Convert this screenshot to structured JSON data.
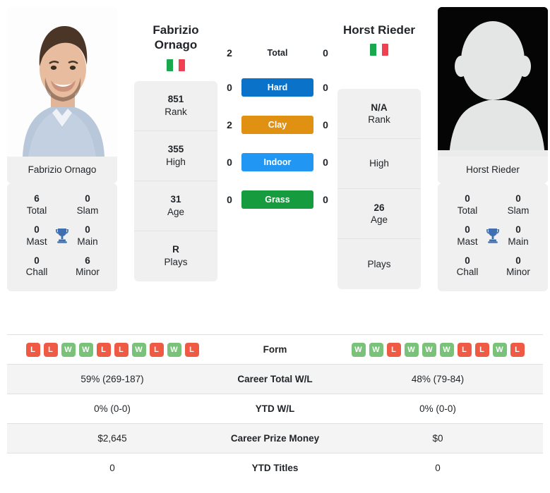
{
  "players": {
    "left": {
      "name": "Fabrizio Ornago",
      "name_line1": "Fabrizio",
      "name_line2": "Ornago",
      "caption": "Fabrizio Ornago",
      "flag": "italy",
      "info": [
        {
          "value": "851",
          "label": "Rank"
        },
        {
          "value": "355",
          "label": "High"
        },
        {
          "value": "31",
          "label": "Age"
        },
        {
          "value": "R",
          "label": "Plays"
        }
      ],
      "titles": [
        {
          "value": "6",
          "label": "Total"
        },
        {
          "value": "0",
          "label": "Slam"
        },
        {
          "value": "0",
          "label": "Mast"
        },
        {
          "value": "0",
          "label": "Main"
        },
        {
          "value": "0",
          "label": "Chall"
        },
        {
          "value": "6",
          "label": "Minor"
        }
      ],
      "form": [
        "L",
        "L",
        "W",
        "W",
        "L",
        "L",
        "W",
        "L",
        "W",
        "L"
      ],
      "career_total_wl": "59% (269-187)",
      "ytd_wl": "0% (0-0)",
      "career_prize_money": "$2,645",
      "ytd_titles": "0"
    },
    "right": {
      "name": "Horst Rieder",
      "name_line1": "Horst Rieder",
      "name_line2": "",
      "caption": "Horst Rieder",
      "flag": "italy",
      "info": [
        {
          "value": "N/A",
          "label": "Rank"
        },
        {
          "value": "",
          "label": "High"
        },
        {
          "value": "26",
          "label": "Age"
        },
        {
          "value": "",
          "label": "Plays"
        }
      ],
      "titles": [
        {
          "value": "0",
          "label": "Total"
        },
        {
          "value": "0",
          "label": "Slam"
        },
        {
          "value": "0",
          "label": "Mast"
        },
        {
          "value": "0",
          "label": "Main"
        },
        {
          "value": "0",
          "label": "Chall"
        },
        {
          "value": "0",
          "label": "Minor"
        }
      ],
      "form": [
        "W",
        "W",
        "L",
        "W",
        "W",
        "W",
        "L",
        "L",
        "W",
        "L"
      ],
      "career_total_wl": "48% (79-84)",
      "ytd_wl": "0% (0-0)",
      "career_prize_money": "$0",
      "ytd_titles": "0"
    }
  },
  "h2h": [
    {
      "label": "Total",
      "left": "2",
      "right": "0",
      "badge": false,
      "color": ""
    },
    {
      "label": "Hard",
      "left": "0",
      "right": "0",
      "badge": true,
      "color": "#0b72c9"
    },
    {
      "label": "Clay",
      "left": "2",
      "right": "0",
      "badge": true,
      "color": "#e09112"
    },
    {
      "label": "Indoor",
      "left": "0",
      "right": "0",
      "badge": true,
      "color": "#2196f3"
    },
    {
      "label": "Grass",
      "left": "0",
      "right": "0",
      "badge": true,
      "color": "#169b3e"
    }
  ],
  "table_rows": [
    {
      "label": "Form",
      "type": "form"
    },
    {
      "label": "Career Total W/L",
      "type": "text",
      "key": "career_total_wl"
    },
    {
      "label": "YTD W/L",
      "type": "text",
      "key": "ytd_wl"
    },
    {
      "label": "Career Prize Money",
      "type": "text",
      "key": "career_prize_money"
    },
    {
      "label": "YTD Titles",
      "type": "text",
      "key": "ytd_titles"
    }
  ],
  "colors": {
    "win": "#7ac27a",
    "loss": "#ef5a45",
    "card_bg": "#f0f0f0",
    "row_alt": "#f4f4f4",
    "flag_green": "#1aa84f",
    "flag_white": "#ffffff",
    "flag_red": "#f04152"
  }
}
